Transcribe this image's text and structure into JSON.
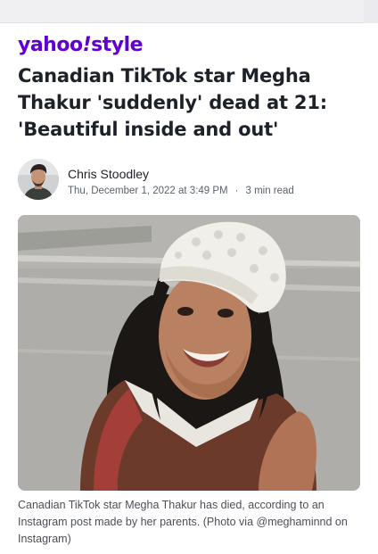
{
  "brand": {
    "logo_main": "yahoo",
    "logo_bang": "!",
    "logo_section": "style",
    "color": "#6001d2"
  },
  "article": {
    "headline": "Canadian TikTok star Megha Thakur 'suddenly' dead at 21: 'Beautiful inside and out'",
    "author": "Chris Stoodley",
    "date": "Thu, December 1, 2022 at 3:49 PM",
    "separator": "·",
    "read_time": "3 min read",
    "caption": "Canadian TikTok star Megha Thakur has died, according to an Instagram post made by her parents. (Photo via @meghaminnd on Instagram)"
  }
}
